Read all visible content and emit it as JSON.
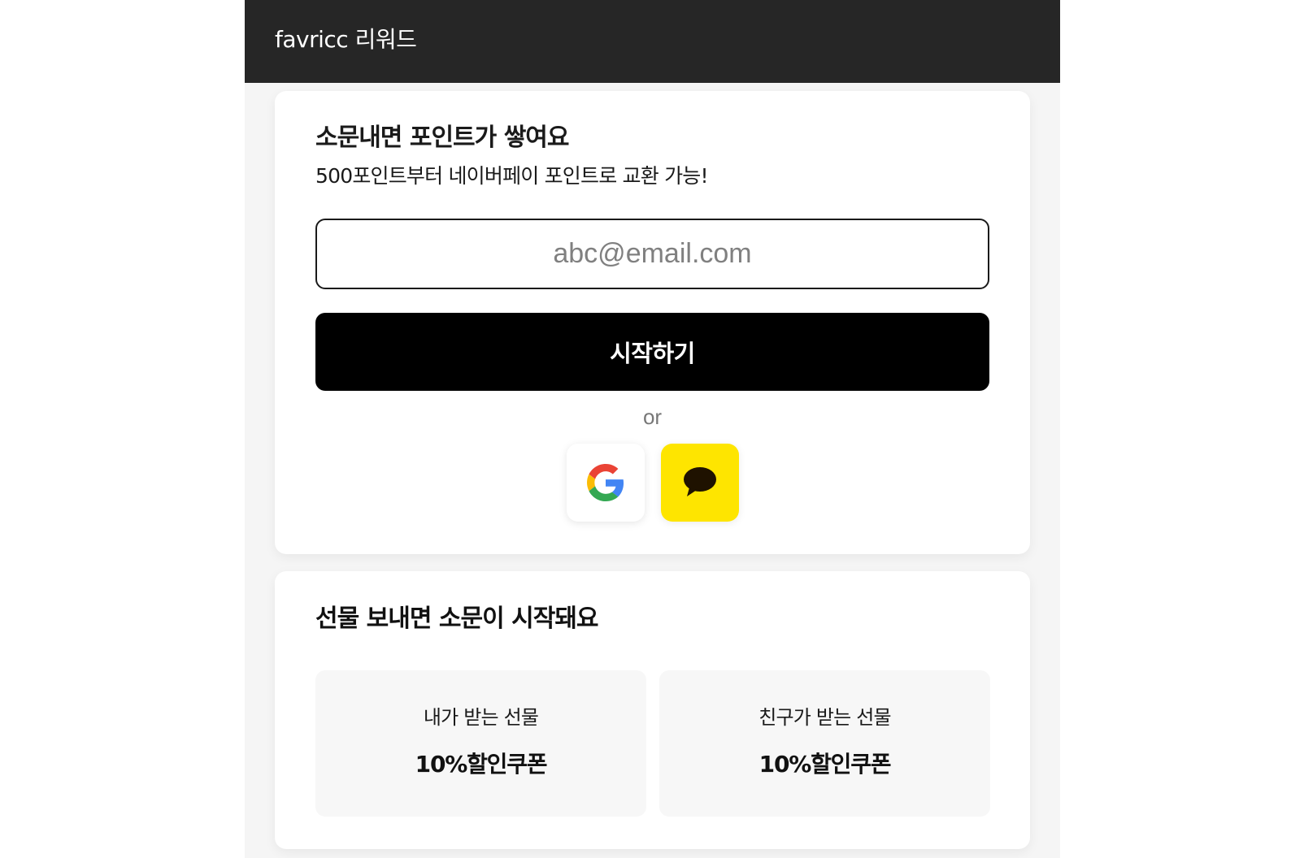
{
  "header": {
    "title": "favricc 리워드"
  },
  "signup_card": {
    "title": "소문내면 포인트가 쌓여요",
    "subtitle": "500포인트부터 네이버페이 포인트로 교환 가능!",
    "email_input": {
      "value": "",
      "placeholder": "abc@email.com"
    },
    "start_button_label": "시작하기",
    "divider_text": "or",
    "social_buttons": [
      {
        "name": "google",
        "icon": "google-icon"
      },
      {
        "name": "kakao",
        "icon": "kakao-chat-bubble-icon",
        "color": "#FEE500"
      }
    ]
  },
  "gift_card": {
    "title": "선물 보내면 소문이 시작돼요",
    "gifts": [
      {
        "label": "내가 받는 선물",
        "value": "10%할인쿠폰"
      },
      {
        "label": "친구가 받는 선물",
        "value": "10%할인쿠폰"
      }
    ]
  },
  "colors": {
    "header_background": "#262626",
    "primary_button": "#000000",
    "kakao": "#FEE500",
    "gift_box_background": "#F7F7F7"
  }
}
